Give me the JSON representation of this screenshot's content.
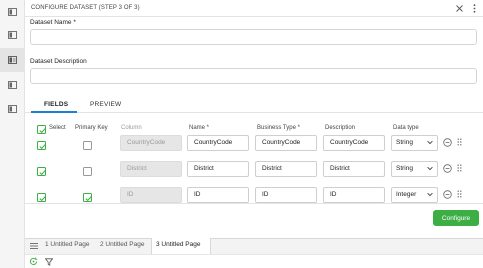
{
  "header": {
    "title": "CONFIGURE DATASET (STEP 3 OF 3)"
  },
  "rail": {
    "icons": [
      "panel-icon",
      "panel-icon",
      "panel-icon-active",
      "panel-icon",
      "panel-icon"
    ]
  },
  "form": {
    "name_label": "Dataset Name *",
    "name_value": "",
    "description_label": "Dataset Description",
    "description_value": ""
  },
  "tabs": [
    {
      "label": "FIELDS",
      "active": true
    },
    {
      "label": "PREVIEW",
      "active": false
    }
  ],
  "table": {
    "headers": {
      "select": "Select",
      "primary_key": "Primary Key",
      "column": "Column",
      "name": "Name *",
      "business_type": "Business Type *",
      "description": "Description",
      "data_type": "Data type"
    },
    "rows": [
      {
        "selected": true,
        "primary_key": false,
        "column": "CountryCode",
        "name": "CountryCode",
        "business_type": "CountryCode",
        "description": "CountryCode",
        "data_type": "String"
      },
      {
        "selected": true,
        "primary_key": false,
        "column": "District",
        "name": "District",
        "business_type": "District",
        "description": "District",
        "data_type": "String"
      },
      {
        "selected": true,
        "primary_key": true,
        "column": "ID",
        "name": "ID",
        "business_type": "ID",
        "description": "ID",
        "data_type": "Integer"
      }
    ]
  },
  "actions": {
    "configure_label": "Configure"
  },
  "page_tabs": [
    {
      "label": "1  Untitled Page",
      "active": false
    },
    {
      "label": "2  Untitled Page",
      "active": false
    },
    {
      "label": "3  Untitled Page",
      "active": true
    }
  ],
  "colors": {
    "accent_green": "#3cae44",
    "tab_underline": "#1d7fd1"
  }
}
